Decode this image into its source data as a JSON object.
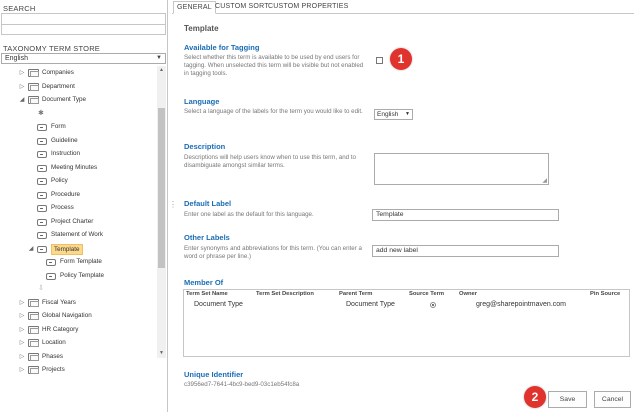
{
  "left_pane": {
    "search_label": "SEARCH",
    "search_value": "",
    "store_label": "TAXONOMY TERM STORE",
    "store_language": "English",
    "tree": [
      {
        "label": "Companies",
        "icon": "folder-icon",
        "expander": "▷"
      },
      {
        "label": "Department",
        "icon": "folder-icon",
        "expander": "▷"
      },
      {
        "label": "Document Type",
        "icon": "folder-icon",
        "expander": "◢"
      },
      {
        "label": "",
        "icon": "gear-icon",
        "expander": ""
      },
      {
        "label": "Form",
        "icon": "term-icon",
        "expander": ""
      },
      {
        "label": "Guideline",
        "icon": "term-icon",
        "expander": ""
      },
      {
        "label": "Instruction",
        "icon": "term-icon",
        "expander": ""
      },
      {
        "label": "Meeting Minutes",
        "icon": "term-icon",
        "expander": ""
      },
      {
        "label": "Policy",
        "icon": "term-icon",
        "expander": ""
      },
      {
        "label": "Procedure",
        "icon": "term-icon",
        "expander": ""
      },
      {
        "label": "Process",
        "icon": "term-icon",
        "expander": ""
      },
      {
        "label": "Project Charter",
        "icon": "term-icon",
        "expander": ""
      },
      {
        "label": "Statement of Work",
        "icon": "term-icon",
        "expander": ""
      },
      {
        "label": "Template",
        "icon": "term-icon",
        "expander": "◢",
        "selected": true
      },
      {
        "label": "Form Template",
        "icon": "term-icon",
        "expander": ""
      },
      {
        "label": "Policy Template",
        "icon": "term-icon",
        "expander": ""
      },
      {
        "label": "",
        "icon": "arrow-icon",
        "expander": ""
      },
      {
        "label": "Fiscal Years",
        "icon": "folder-icon",
        "expander": "▷"
      },
      {
        "label": "Global Navigation",
        "icon": "folder-icon",
        "expander": "▷"
      },
      {
        "label": "HR Category",
        "icon": "folder-icon",
        "expander": "▷"
      },
      {
        "label": "Location",
        "icon": "folder-icon",
        "expander": "▷"
      },
      {
        "label": "Phases",
        "icon": "folder-icon",
        "expander": "▷"
      },
      {
        "label": "Projects",
        "icon": "folder-icon",
        "expander": "▷"
      }
    ]
  },
  "tabs": [
    "GENERAL",
    "CUSTOM SORT",
    "CUSTOM PROPERTIES"
  ],
  "main": {
    "title": "Template",
    "available": {
      "heading": "Available for Tagging",
      "desc": "Select whether this term is available to be used by end users for tagging. When unselected this term will be visible but not enabled in tagging tools."
    },
    "language": {
      "heading": "Language",
      "desc": "Select a language of the labels for the term you would like to edit.",
      "value": "English"
    },
    "description": {
      "heading": "Description",
      "desc": "Descriptions will help users know when to use this term, and to disambiguate amongst similar terms."
    },
    "default_label": {
      "heading": "Default Label",
      "desc": "Enter one label as the default for this language.",
      "value": "Template"
    },
    "other_labels": {
      "heading": "Other Labels",
      "desc": "Enter synonyms and abbreviations for this term. (You can enter a word or phrase per line.)",
      "value": "add new label"
    },
    "member_of": {
      "heading": "Member Of",
      "columns": [
        "Term Set Name",
        "Term Set Description",
        "Parent Term",
        "Source Term",
        "Owner",
        "Pin Source"
      ],
      "row": {
        "term_set_name": "Document Type",
        "term_set_description": "",
        "parent_term": "Document Type",
        "owner": "greg@sharepointmaven.com",
        "pin_source": ""
      }
    },
    "unique_id": {
      "heading": "Unique Identifier",
      "value": "c3956ed7-7641-4bc9-bed9-03c1eb54fc8a"
    }
  },
  "buttons": {
    "save": "Save",
    "cancel": "Cancel"
  },
  "badges": {
    "one": "1",
    "two": "2"
  },
  "colors": {
    "heading_blue": "#1a6cb5",
    "badge_red": "#e0332d",
    "selected_bg": "#fbd88b"
  }
}
